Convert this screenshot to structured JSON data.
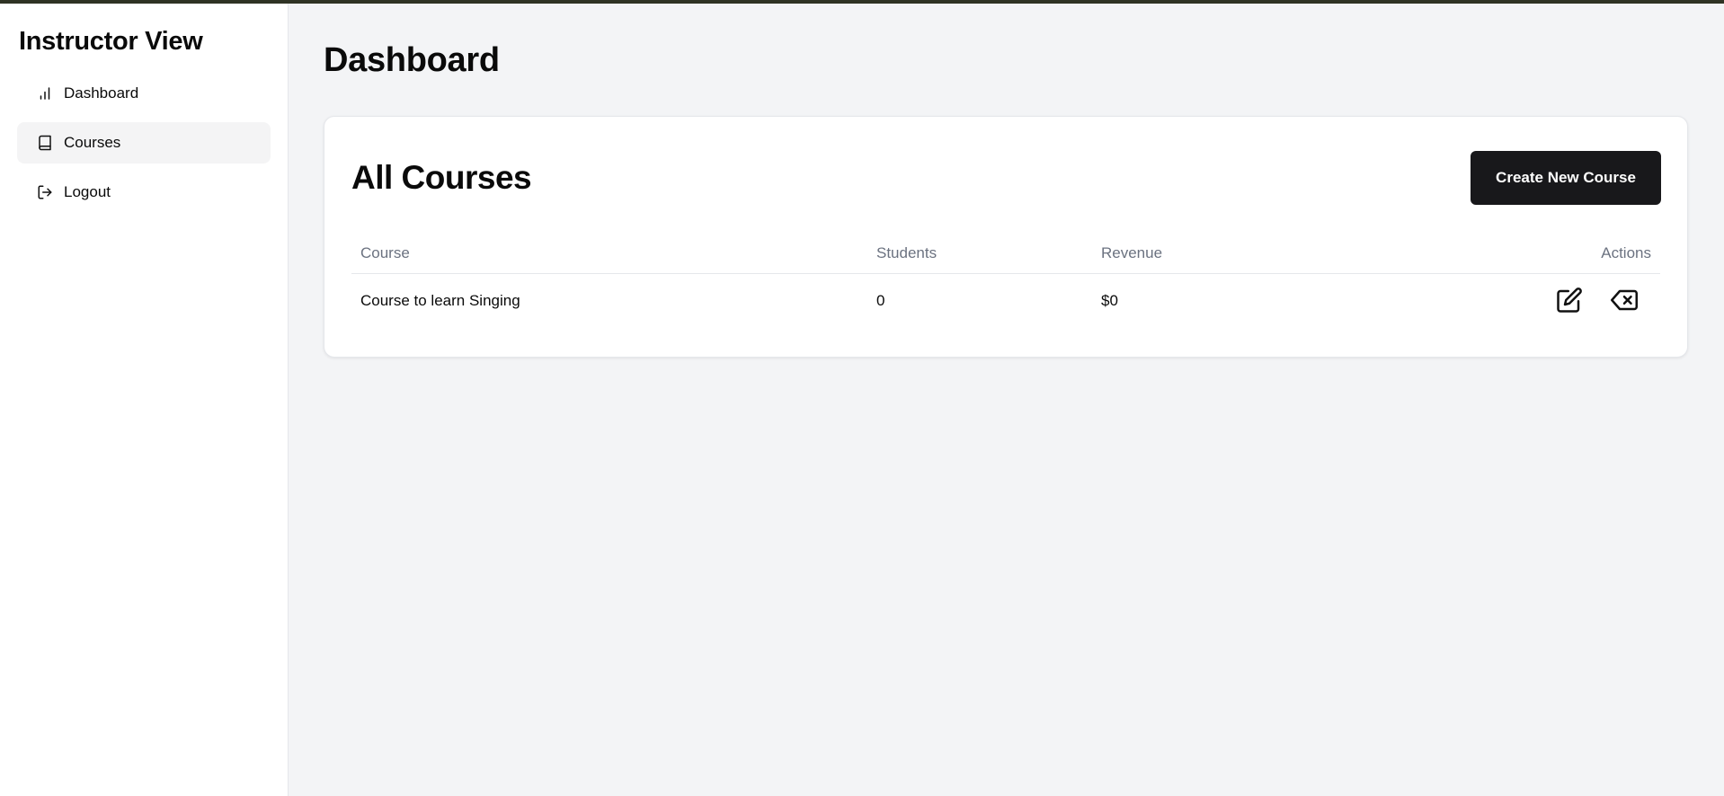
{
  "sidebar": {
    "title": "Instructor View",
    "items": [
      {
        "label": "Dashboard",
        "icon": "bar-chart-icon",
        "active": false
      },
      {
        "label": "Courses",
        "icon": "book-icon",
        "active": true
      },
      {
        "label": "Logout",
        "icon": "logout-icon",
        "active": false
      }
    ]
  },
  "main": {
    "page_title": "Dashboard",
    "card": {
      "title": "All Courses",
      "create_button_label": "Create New Course",
      "table": {
        "headers": [
          "Course",
          "Students",
          "Revenue",
          "Actions"
        ],
        "rows": [
          {
            "course": "Course to learn Singing",
            "students": "0",
            "revenue": "$0",
            "actions": [
              "edit-icon",
              "delete-icon"
            ]
          }
        ]
      }
    }
  },
  "colors": {
    "background": "#f3f4f6",
    "sidebar_bg": "#ffffff",
    "active_item_bg": "#f4f4f5",
    "primary_button": "#18181b",
    "header_text": "#6b7280",
    "top_bar": "#2f3324"
  }
}
